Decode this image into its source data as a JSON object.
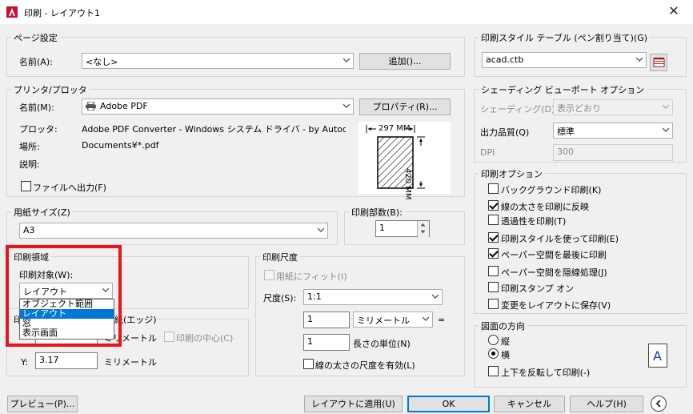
{
  "window": {
    "title": "印刷 - レイアウト1"
  },
  "page_setup": {
    "group_label": "ページ設定",
    "name_label": "名前(A):",
    "name_value": "<なし>",
    "add_button": "追加()..."
  },
  "printer": {
    "group_label": "プリンタ/プロッタ",
    "name_label": "名前(M):",
    "name_value": "Adobe PDF",
    "properties_button": "プロパティ(R)...",
    "plotter_label": "プロッタ:",
    "plotter_value": "Adobe PDF Converter - Windows システム ドライバ - by Autode...",
    "location_label": "場所:",
    "location_value": "Documents¥*.pdf",
    "description_label": "説明:",
    "print_to_file_label": "ファイルへ出力(F)",
    "print_to_file_checked": false,
    "preview_width": "297 MM",
    "preview_height": "420 MM"
  },
  "paper_size": {
    "group_label": "用紙サイズ(Z)",
    "value": "A3"
  },
  "copies": {
    "group_label": "印刷部数(B):",
    "value": "1"
  },
  "plot_area": {
    "group_label": "印刷領域",
    "what_label": "印刷対象(W):",
    "what_value": "レイアウト",
    "options": [
      "オブジェクト範囲",
      "レイアウト",
      "窓",
      "表示画面"
    ],
    "selected_index": 1
  },
  "plot_offset": {
    "group_label_visible": "印",
    "group_label_tail": "紙(エッジ)",
    "x_unit": "ミリメートル",
    "center_label": "印刷の中心(C)",
    "center_checked": false,
    "y_label": "Y:",
    "y_value": "3.17",
    "y_unit": "ミリメートル"
  },
  "plot_scale": {
    "group_label": "印刷尺度",
    "fit_label": "用紙にフィット(I)",
    "fit_checked": false,
    "scale_label": "尺度(S):",
    "scale_value": "1:1",
    "value1": "1",
    "unit_value": "ミリメートル",
    "equals": "=",
    "value2": "1",
    "unit_label": "長さの単位(N)",
    "lineweights_label": "線の太さの尺度を有効(L)",
    "lineweights_checked": false
  },
  "plot_style_table": {
    "group_label": "印刷スタイル テーブル (ペン割り当て)(G)",
    "value": "acad.ctb"
  },
  "shaded_viewport": {
    "group_label": "シェーディング ビューポート オプション",
    "shade_label": "シェーディング(D)",
    "shade_value": "表示どおり",
    "quality_label": "出力品質(Q)",
    "quality_value": "標準",
    "dpi_label": "DPI",
    "dpi_value": "300"
  },
  "plot_options": {
    "group_label": "印刷オプション",
    "items": [
      {
        "label": "バックグラウンド印刷(K)",
        "checked": false
      },
      {
        "label": "線の太さを印刷に反映",
        "checked": true
      },
      {
        "label": "透過性を印刷(T)",
        "checked": false
      },
      {
        "label": "印刷スタイルを使って印刷(E)",
        "checked": true
      },
      {
        "label": "ペーパー空間を最後に印刷",
        "checked": true
      },
      {
        "label": "ペーパー空間を隠線処理(J)",
        "checked": false
      },
      {
        "label": "印刷スタンプ オン",
        "checked": false
      },
      {
        "label": "変更をレイアウトに保存(V)",
        "checked": false
      }
    ]
  },
  "orientation": {
    "group_label": "図面の方向",
    "portrait_label": "縦",
    "landscape_label": "横",
    "selected": "landscape",
    "upside_down_label": "上下を反転して印刷(-)",
    "upside_down_checked": false,
    "icon_letter": "A"
  },
  "buttons": {
    "preview": "プレビュー(P)...",
    "apply": "レイアウトに適用(U)",
    "ok": "OK",
    "cancel": "キャンセル",
    "help": "ヘルプ(H)"
  },
  "colors": {
    "highlight": "#0078d7",
    "annotation_red": "#e8141b"
  }
}
